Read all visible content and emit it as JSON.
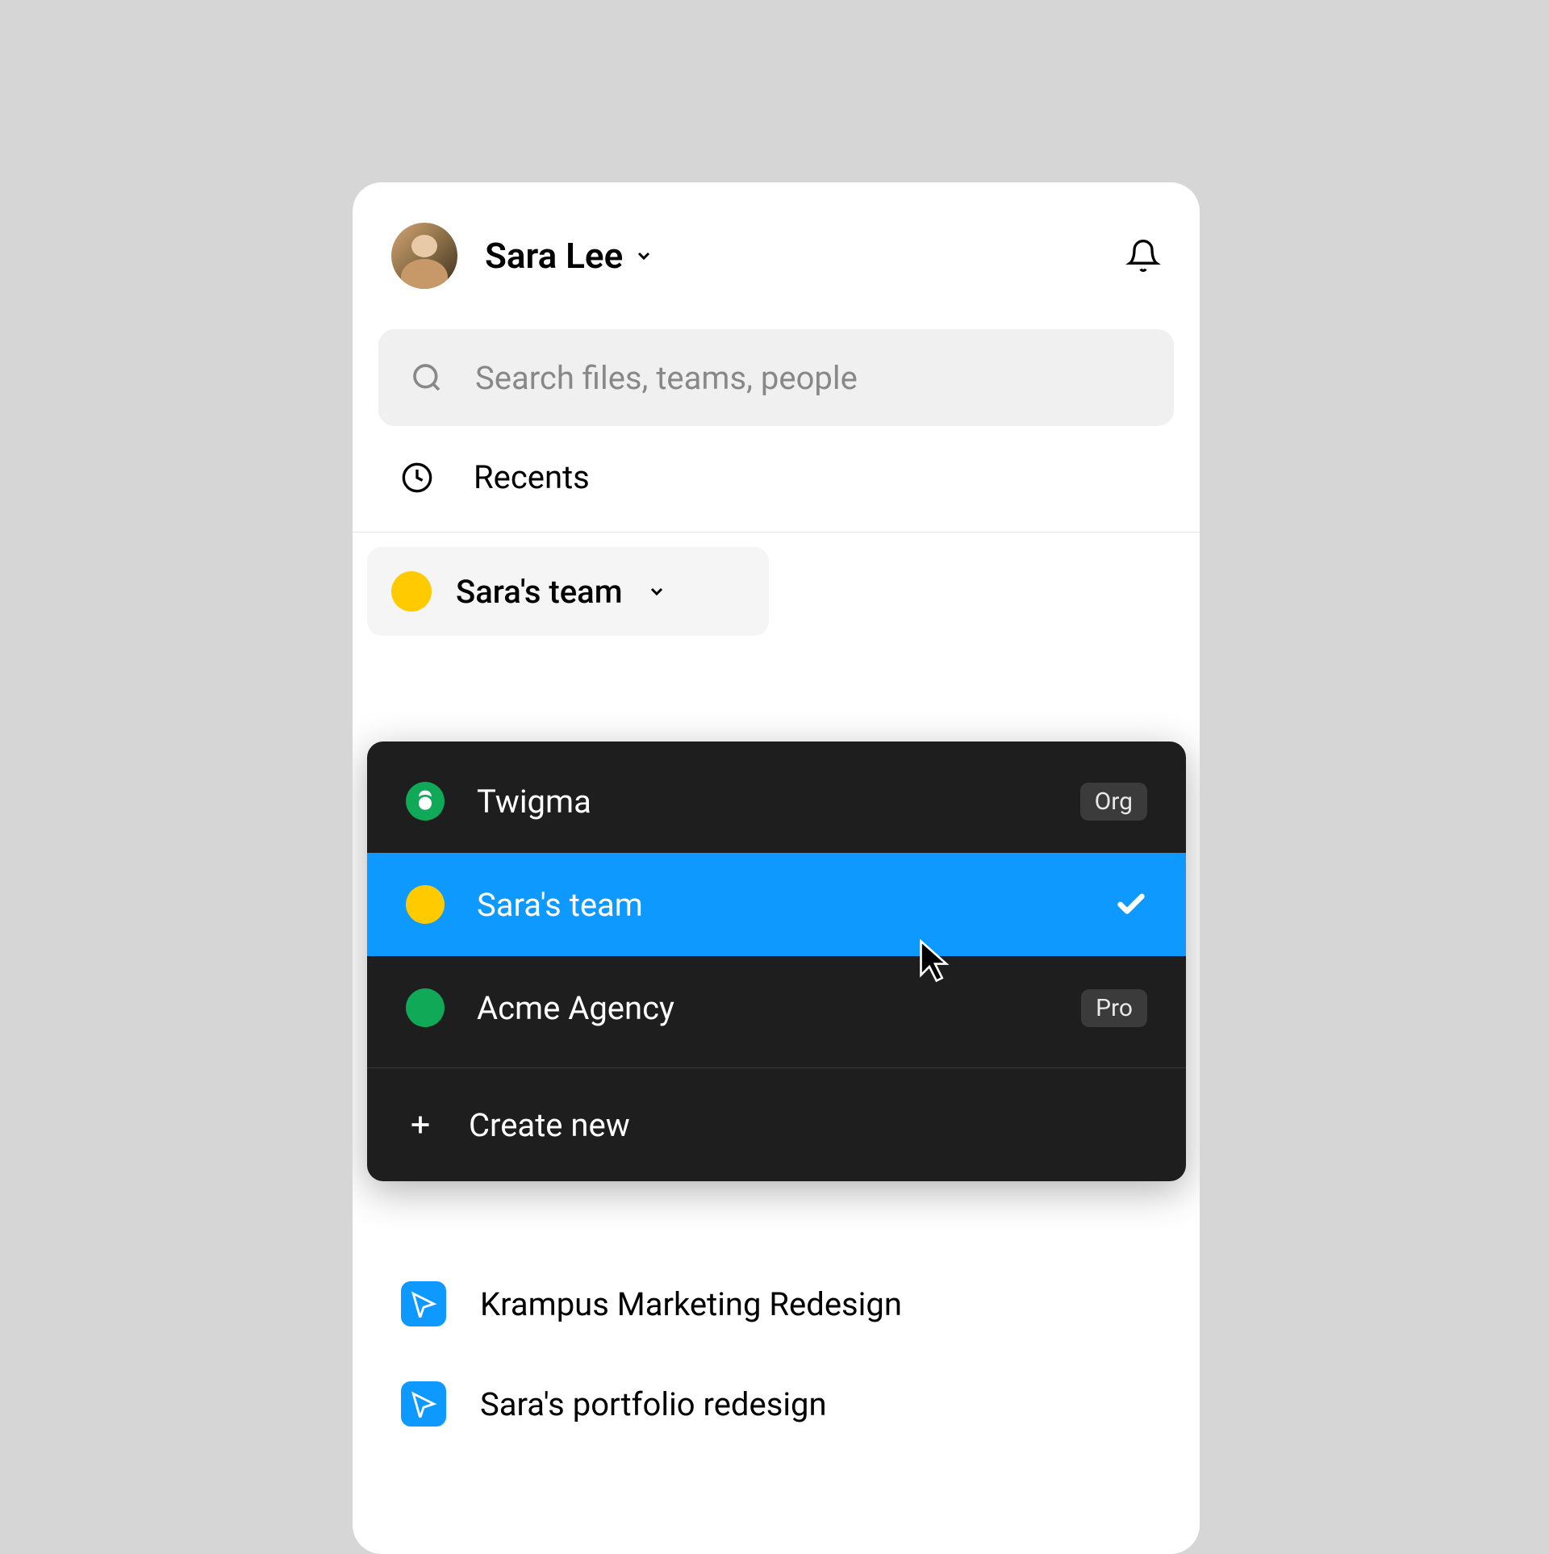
{
  "header": {
    "user_name": "Sara Lee"
  },
  "search": {
    "placeholder": "Search files, teams, people"
  },
  "nav": {
    "recents_label": "Recents"
  },
  "team_selector": {
    "current": "Sara's team",
    "color": "yellow"
  },
  "dropdown": {
    "items": [
      {
        "label": "Twigma",
        "badge": "Org",
        "color": "org-green",
        "selected": false
      },
      {
        "label": "Sara's team",
        "badge": null,
        "color": "yellow",
        "selected": true
      },
      {
        "label": "Acme Agency",
        "badge": "Pro",
        "color": "green",
        "selected": false
      }
    ],
    "create_label": "Create new"
  },
  "files": [
    {
      "name": "Krampus Marketing Redesign"
    },
    {
      "name": "Sara's portfolio redesign"
    }
  ]
}
